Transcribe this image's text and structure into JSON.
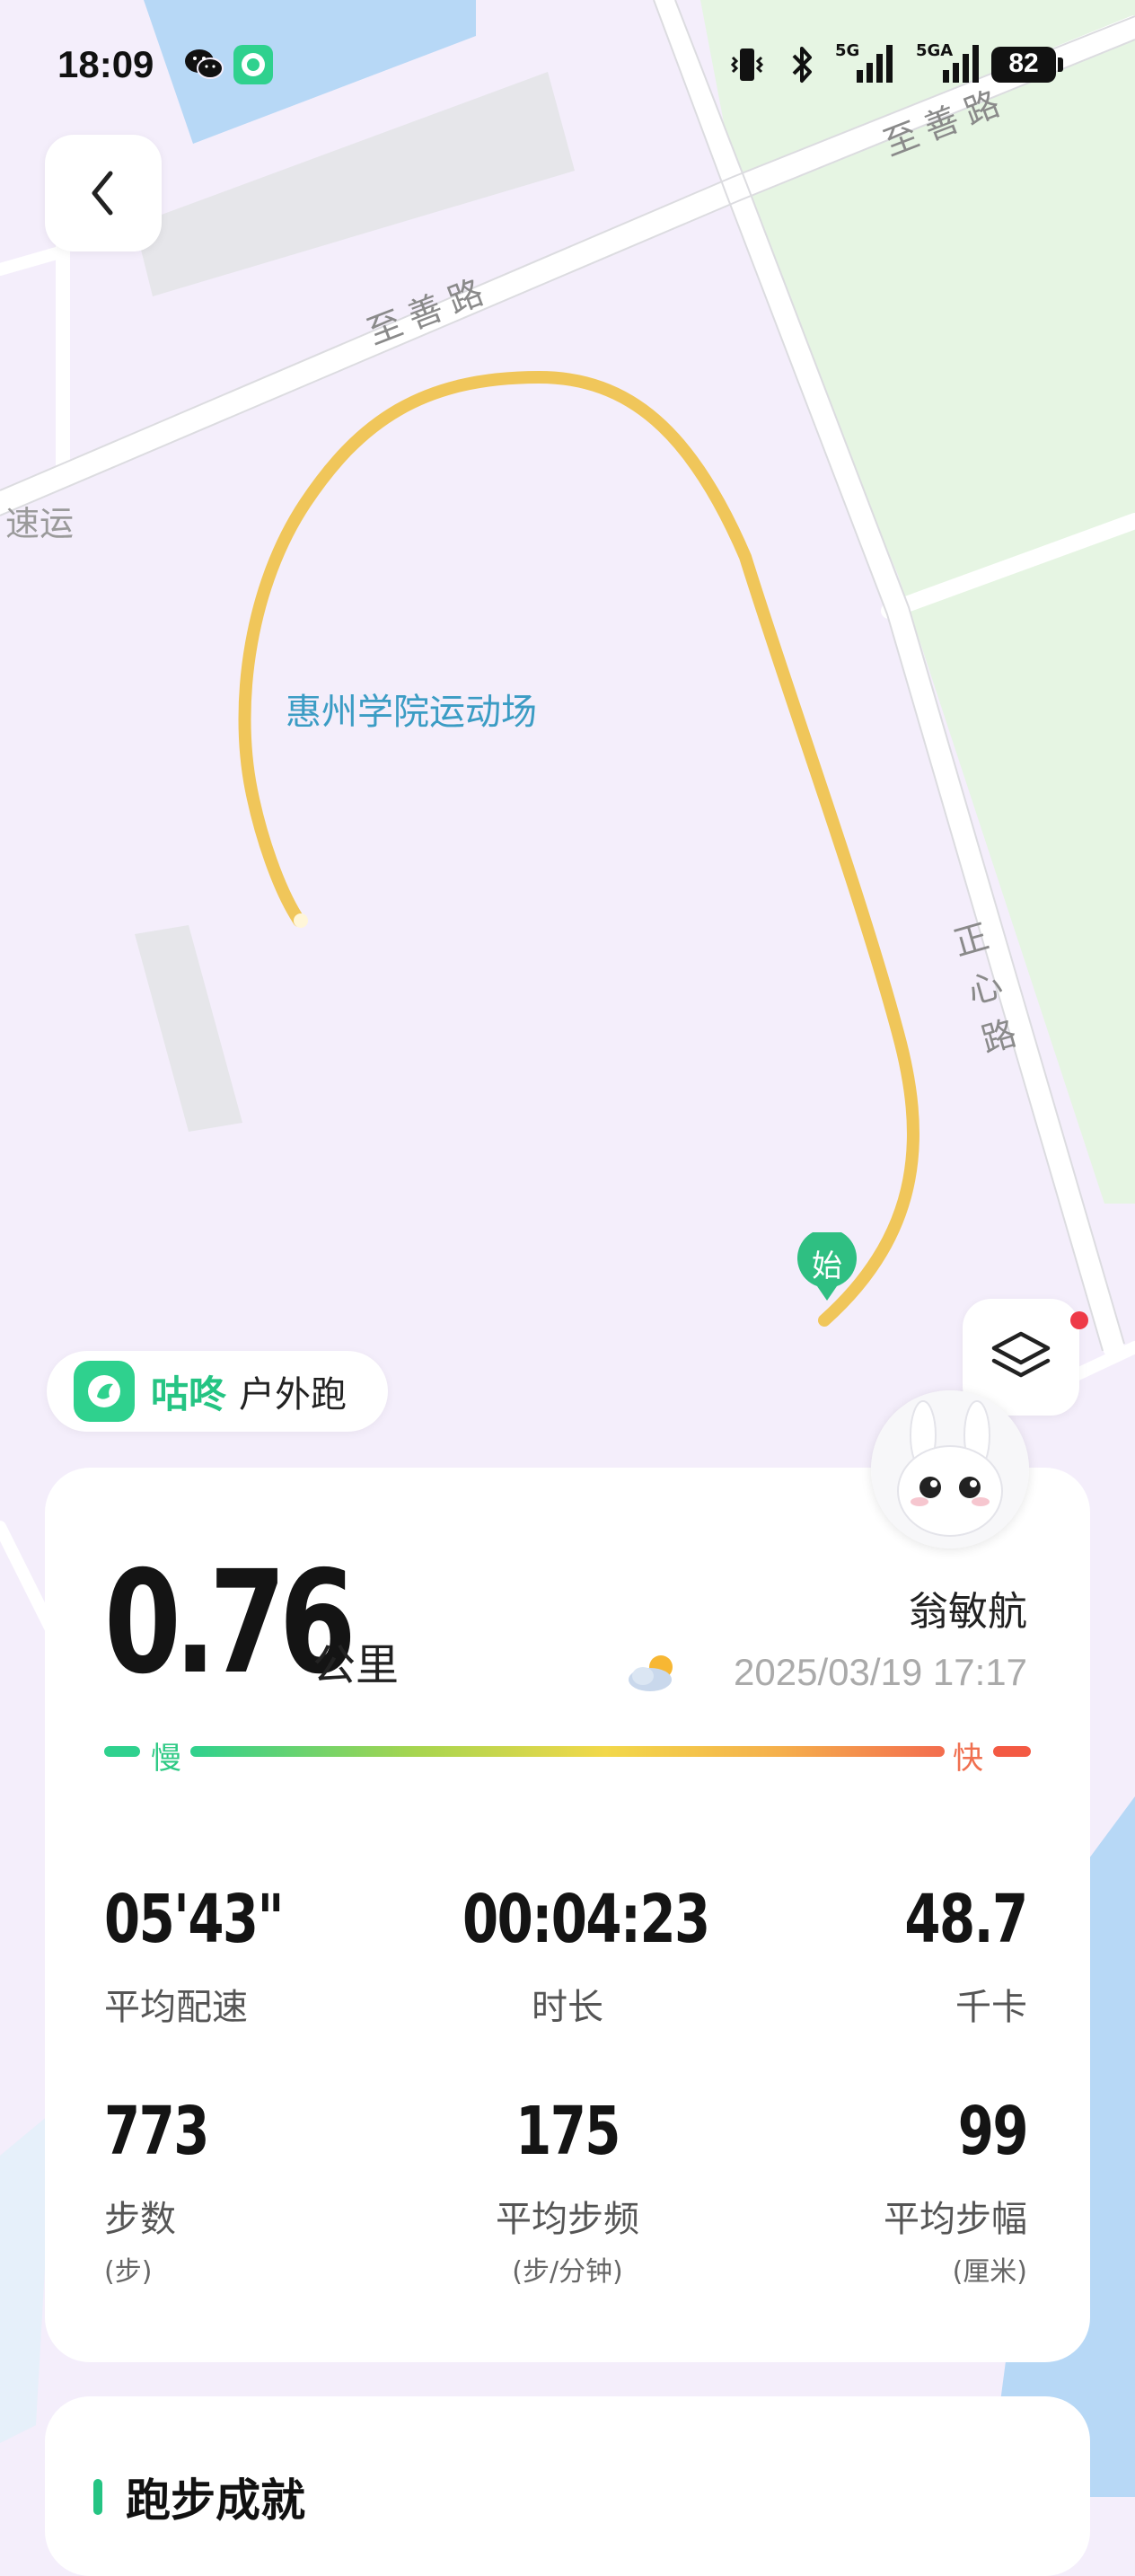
{
  "status_bar": {
    "time": "18:09",
    "battery": "82",
    "signal1": "5G",
    "signal2": "5GA"
  },
  "map": {
    "road_top": "至善路",
    "road_upper_right": "至善路",
    "road_right": "正心路",
    "place_left": "速运",
    "venue": "惠州学院运动场",
    "start_marker": "始",
    "track_color": "#f0c65a"
  },
  "brand": {
    "name": "咕咚",
    "mode": "户外跑"
  },
  "summary": {
    "distance": "0.76",
    "distance_unit": "公里",
    "user_name": "翁敏航",
    "datetime": "2025/03/19 17:17",
    "pace_slow": "慢",
    "pace_fast": "快"
  },
  "stats": [
    {
      "value": "05'43\"",
      "label": "平均配速",
      "sub": ""
    },
    {
      "value": "00:04:23",
      "label": "时长",
      "sub": ""
    },
    {
      "value": "48.7",
      "label": "千卡",
      "sub": ""
    },
    {
      "value": "773",
      "label": "步数",
      "sub": "(步)"
    },
    {
      "value": "175",
      "label": "平均步频",
      "sub": "(步/分钟)"
    },
    {
      "value": "99",
      "label": "平均步幅",
      "sub": "(厘米)"
    }
  ],
  "section2": {
    "title": "跑步成就"
  },
  "icons": {
    "back": "chevron-left-icon",
    "layers": "layers-icon",
    "weather": "partly-cloudy-icon",
    "brand": "codoon-logo-icon"
  },
  "colors": {
    "brand_green": "#25c483",
    "track": "#f0c65a",
    "notification": "#ee3a48"
  }
}
